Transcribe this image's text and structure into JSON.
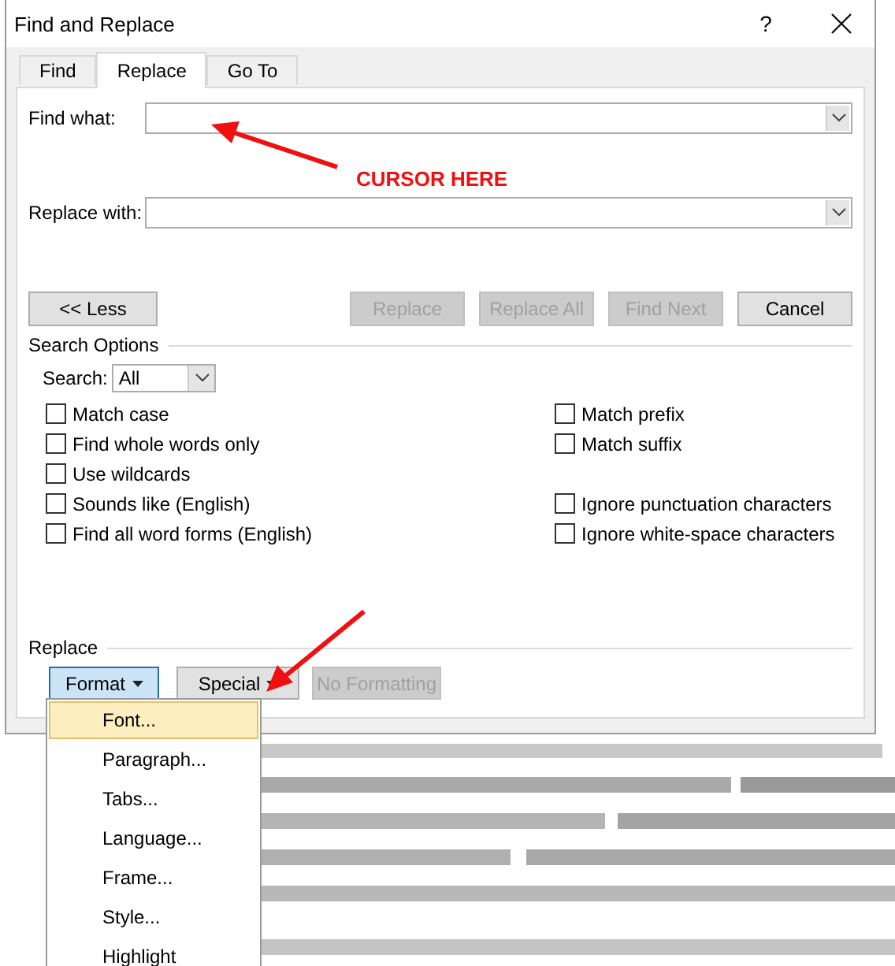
{
  "window": {
    "title": "Find and Replace",
    "help": "?"
  },
  "tabs": [
    {
      "label": "Find",
      "selected": false
    },
    {
      "label": "Replace",
      "selected": true
    },
    {
      "label": "Go To",
      "selected": false
    }
  ],
  "fields": [
    {
      "label": "Find what:"
    },
    {
      "label": "Replace with:"
    }
  ],
  "buttons": [
    {
      "label": "<< Less",
      "disabled": false
    },
    {
      "label": "Replace",
      "disabled": true
    },
    {
      "label": "Replace All",
      "disabled": true
    },
    {
      "label": "Find Next",
      "disabled": true
    },
    {
      "label": "Cancel",
      "disabled": false
    }
  ],
  "search_options": {
    "heading": "Search Options",
    "search_label": "Search:",
    "search_value": "All",
    "rows": [
      {
        "left": {
          "label": "Match case",
          "checked": false
        },
        "right": {
          "label": "Match prefix",
          "checked": false
        }
      },
      {
        "left": {
          "label": "Find whole words only",
          "checked": false
        },
        "right": {
          "label": "Match suffix",
          "checked": false
        }
      },
      {
        "left": {
          "label": "Use wildcards",
          "checked": false
        }
      },
      {
        "left": {
          "label": "Sounds like (English)",
          "checked": false
        },
        "right": {
          "label": "Ignore punctuation characters",
          "checked": false
        }
      },
      {
        "left": {
          "label": "Find all word forms (English)",
          "checked": false
        },
        "right": {
          "label": "Ignore white-space characters",
          "checked": false
        }
      }
    ]
  },
  "replace": {
    "heading": "Replace",
    "buttons": [
      {
        "label": "Format",
        "dropdown": true,
        "disabled": false,
        "expanded": true
      },
      {
        "label": "Special",
        "dropdown": true,
        "disabled": false,
        "expanded": false
      },
      {
        "label": "No Formatting",
        "dropdown": false,
        "disabled": true,
        "expanded": false
      }
    ]
  },
  "menu": [
    {
      "label": "Font...",
      "selected": true
    },
    {
      "label": "Paragraph...",
      "selected": false
    },
    {
      "label": "Tabs...",
      "selected": false
    },
    {
      "label": "Language...",
      "selected": false
    },
    {
      "label": "Frame...",
      "selected": false
    },
    {
      "label": "Style...",
      "selected": false
    },
    {
      "label": "Highlight",
      "selected": false
    }
  ],
  "annotation": "CURSOR HERE"
}
